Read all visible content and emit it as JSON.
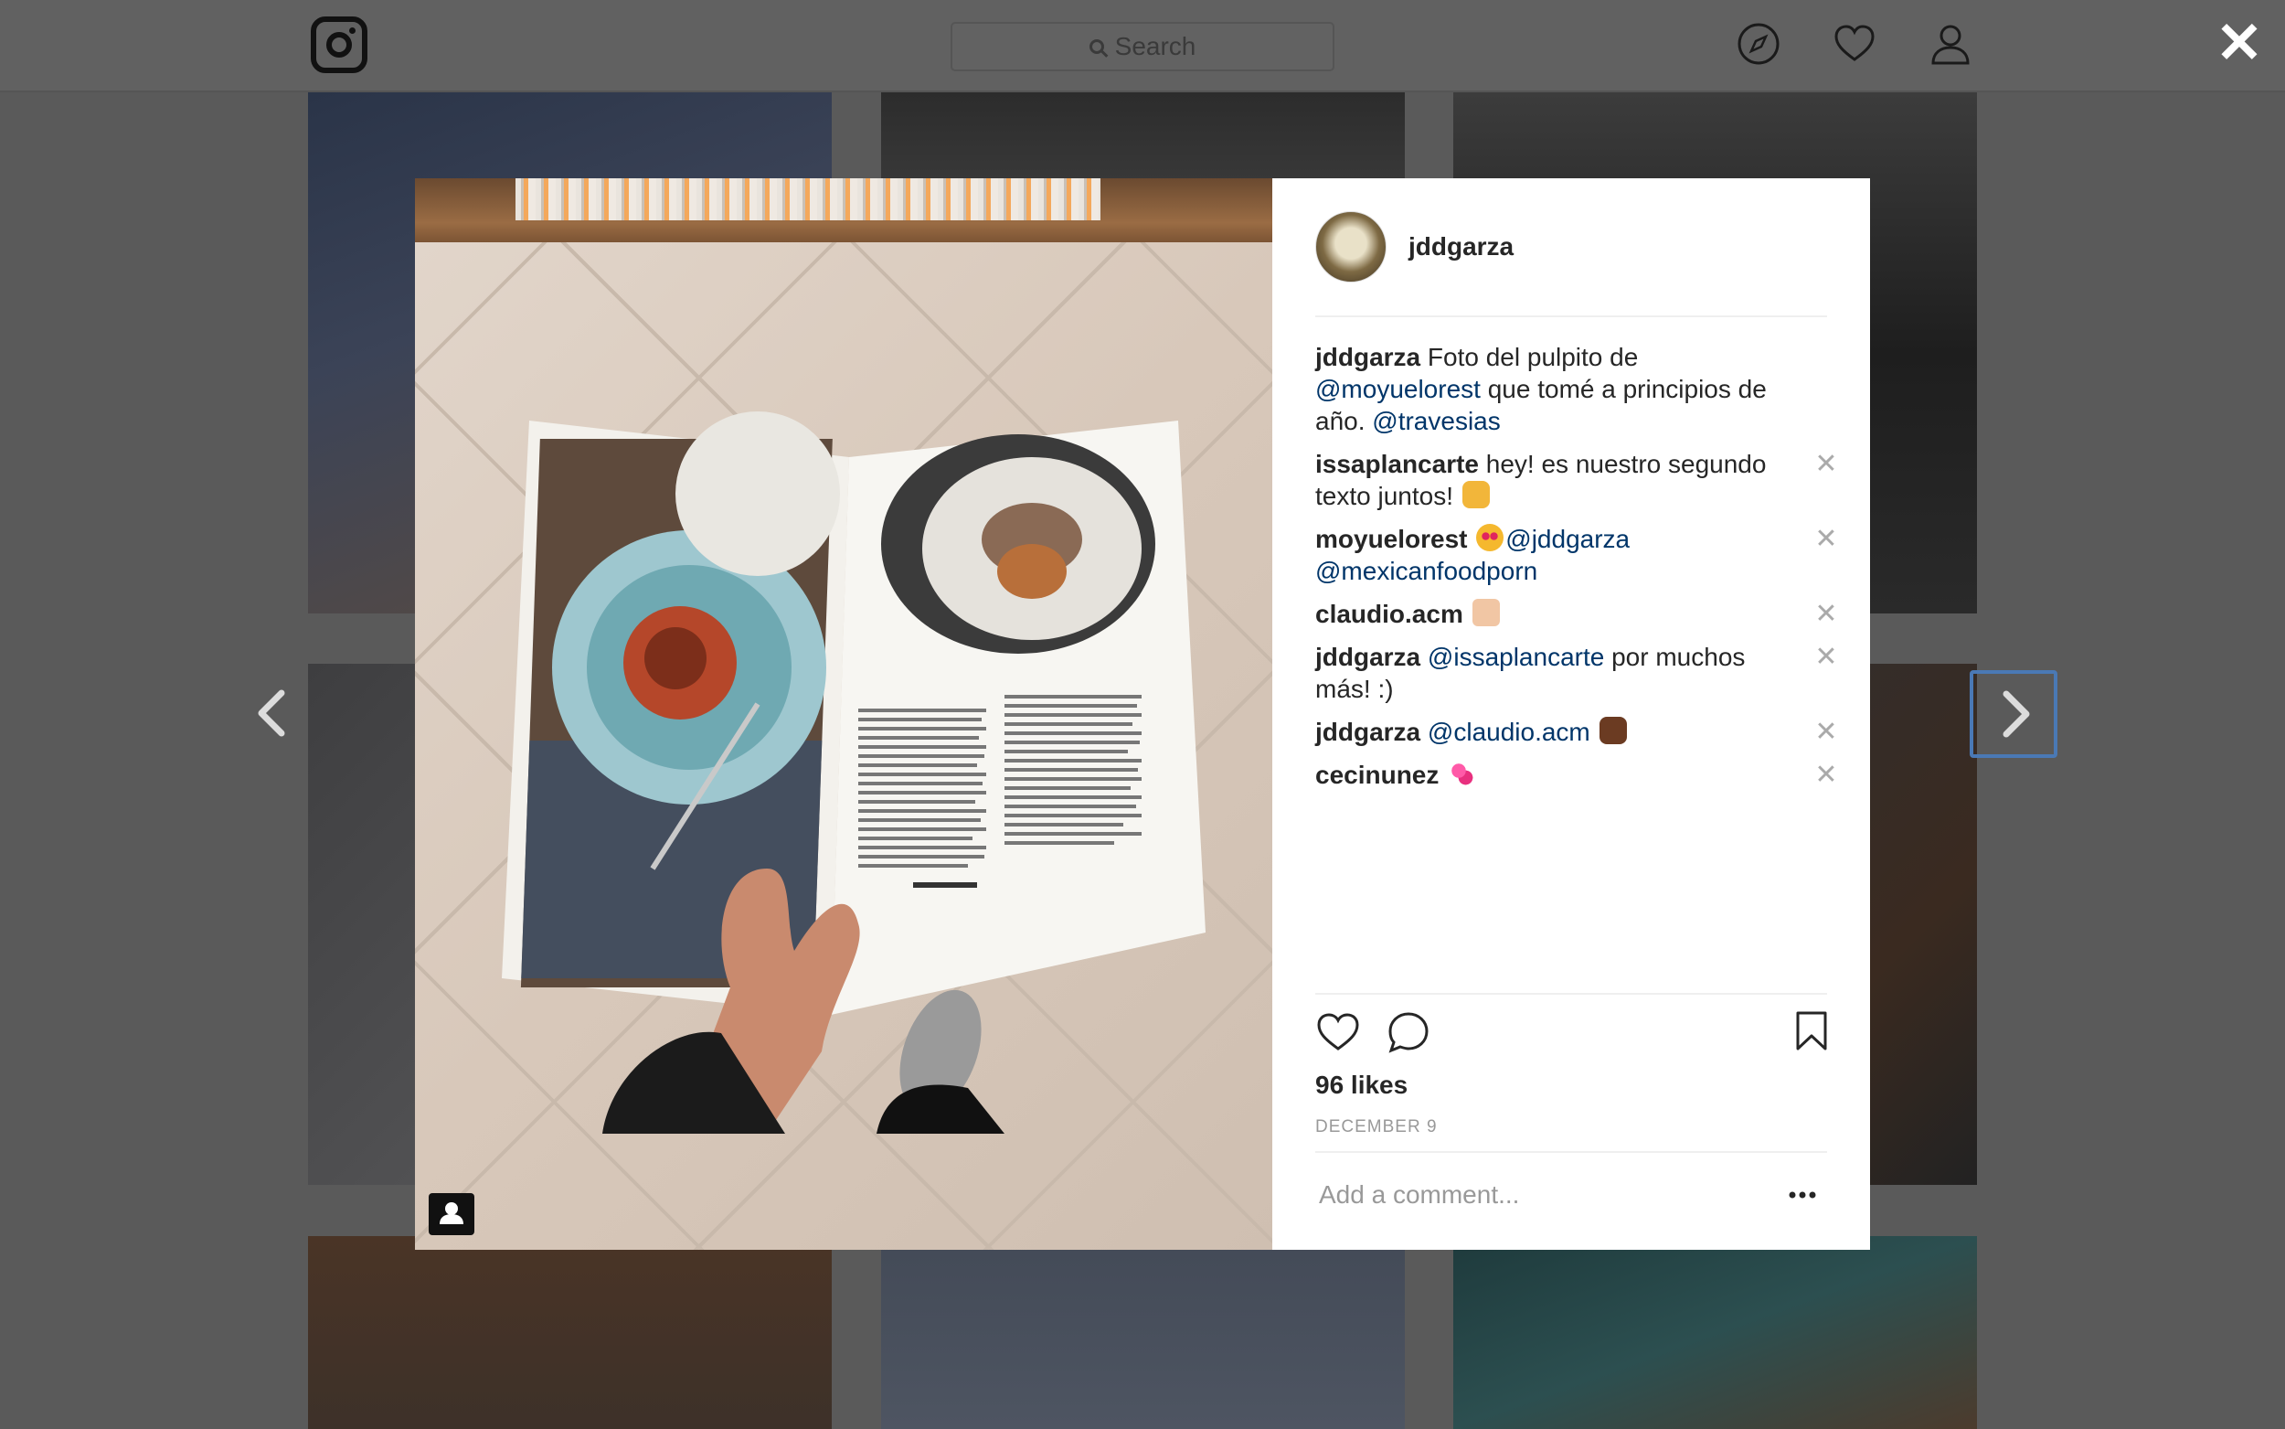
{
  "header": {
    "search_placeholder": "Search"
  },
  "modal": {
    "author": "jddgarza",
    "comments": [
      {
        "user": "jddgarza",
        "parts": [
          "Foto del pulpito de ",
          "@moyuelorest",
          " que tomé a principios de año. ",
          "@travesias"
        ],
        "deletable": false
      },
      {
        "user": "issaplancarte",
        "text": "hey! es nuestro segundo texto juntos!",
        "emoji": "punch",
        "deletable": true
      },
      {
        "user": "moyuelorest",
        "emoji": "heart-eyes",
        "mention1": "@jddgarza",
        "mention2": "@mexicanfoodporn",
        "deletable": true
      },
      {
        "user": "claudio.acm",
        "emoji": "clap",
        "deletable": true
      },
      {
        "user": "jddgarza",
        "mention": "@issaplancarte",
        "text": " por muchos más! :)",
        "deletable": true
      },
      {
        "user": "jddgarza",
        "mention": "@claudio.acm",
        "emoji": "fist",
        "deletable": true
      },
      {
        "user": "cecinunez",
        "emoji": "two-hearts",
        "deletable": true
      }
    ],
    "likes": "96 likes",
    "date": "DECEMBER 9",
    "add_comment_placeholder": "Add a comment...",
    "delete_glyph": "✕"
  },
  "close_glyph": "✕",
  "colors": {
    "mention": "#003569",
    "next_arrow_focus": "#4a79b5"
  }
}
